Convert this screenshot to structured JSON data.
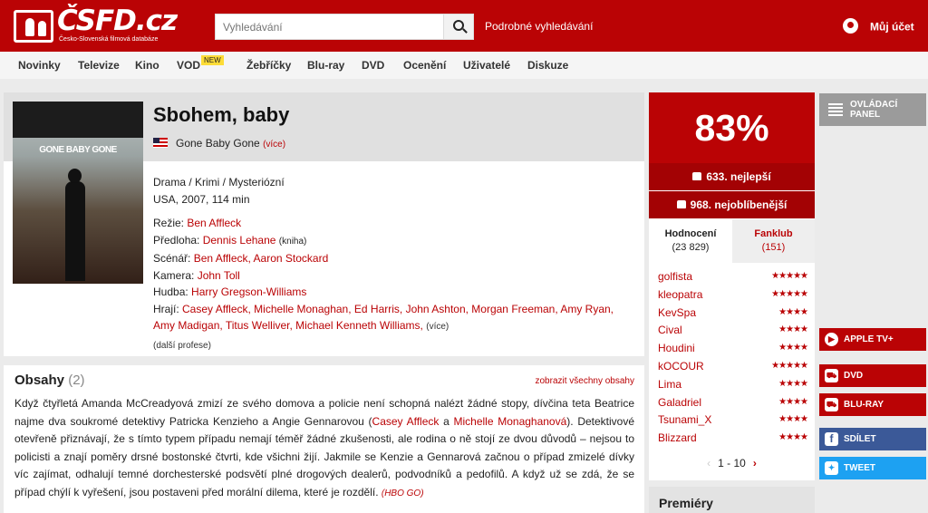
{
  "header": {
    "logo_text": "ČSFD.cz",
    "logo_sub": "Česko-Slovenská filmová databáze",
    "search_placeholder": "Vyhledávání",
    "advanced_search": "Podrobné vyhledávání",
    "account": "Můj účet",
    "brand_color": "#ba0305"
  },
  "nav": {
    "items": [
      "Novinky",
      "Televize",
      "Kino",
      "VOD",
      "Žebříčky",
      "Blu-ray",
      "DVD",
      "Ocenění",
      "Uživatelé",
      "Diskuze"
    ],
    "badge": "NEW"
  },
  "film": {
    "title": "Sbohem, baby",
    "original_title": "Gone Baby Gone",
    "more": "(více)",
    "poster_text": "GONE BABY GONE",
    "genres": "Drama / Krimi / Mysteriózní",
    "origin": "USA, 2007, 114 min",
    "credits": [
      {
        "label": "Režie:",
        "value": "Ben Affleck"
      },
      {
        "label": "Předloha:",
        "value": "Dennis Lehane",
        "note": "(kniha)"
      },
      {
        "label": "Scénář:",
        "value": "Ben Affleck, Aaron Stockard"
      },
      {
        "label": "Kamera:",
        "value": "John Toll"
      },
      {
        "label": "Hudba:",
        "value": "Harry Gregson-Williams"
      }
    ],
    "cast_label": "Hrají:",
    "cast": "Casey Affleck, Michelle Monaghan, Ed Harris, John Ashton, Morgan Freeman, Amy Ryan, Amy Madigan, Titus Welliver, Michael Kenneth Williams,",
    "cast_more": "(více)",
    "other_professions": "(další profese)"
  },
  "plot": {
    "title": "Obsahy",
    "count": "(2)",
    "show_all": "zobrazit všechny obsahy",
    "text_1": "Když čtyřletá Amanda McCreadyová zmizí ze svého domova a policie není schopná nalézt žádné stopy, dívčina teta Beatrice najme dva soukromé detektivy Patricka Kenzieho a Angie Gennarovou (",
    "link_1": "Casey Affleck",
    "text_2": " a ",
    "link_2": "Michelle Monaghanová",
    "text_3": "). Detektivové otevřeně přiznávají, že s tímto typem případu nemají téměř žádné zkušenosti, ale rodina o ně stojí ze dvou důvodů – nejsou to policisti a znají poměry drsné bostonské čtvrti, kde všichni žijí. Jakmile se Kenzie a Gennarová začnou o případ zmizelé dívky víc zajímat, odhalují temné dorchesterské podsvětí plné drogových dealerů, podvodníků a pedofilů. A když už se zdá, že se případ chýlí k vyřešení, jsou postaveni před morální dilema, které je rozdělí.",
    "source": "(HBO GO)"
  },
  "rating": {
    "percent": "83%",
    "best": "633. nejlepší",
    "favorite": "968. nejoblíbenější",
    "tab_ratings": "Hodnocení",
    "tab_ratings_count": "(23 829)",
    "tab_fanclub": "Fanklub",
    "tab_fanclub_count": "(151)",
    "users": [
      {
        "name": "golfista",
        "stars": "★★★★★"
      },
      {
        "name": "kleopatra",
        "stars": "★★★★★"
      },
      {
        "name": "KevSpa",
        "stars": "★★★★"
      },
      {
        "name": "Cival",
        "stars": "★★★★"
      },
      {
        "name": "Houdini",
        "stars": "★★★★"
      },
      {
        "name": "kOCOUR",
        "stars": "★★★★★"
      },
      {
        "name": "Lima",
        "stars": "★★★★"
      },
      {
        "name": "Galadriel",
        "stars": "★★★★"
      },
      {
        "name": "Tsunami_X",
        "stars": "★★★★"
      },
      {
        "name": "Blizzard",
        "stars": "★★★★"
      }
    ],
    "pager": "1 - 10"
  },
  "premieres": "Premiéry",
  "side": {
    "control_panel": "OVLÁDACÍ PANEL",
    "apple": "APPLE TV+",
    "dvd": "DVD",
    "bluray": "BLU-RAY",
    "share": "SDÍLET",
    "tweet": "TWEET"
  }
}
